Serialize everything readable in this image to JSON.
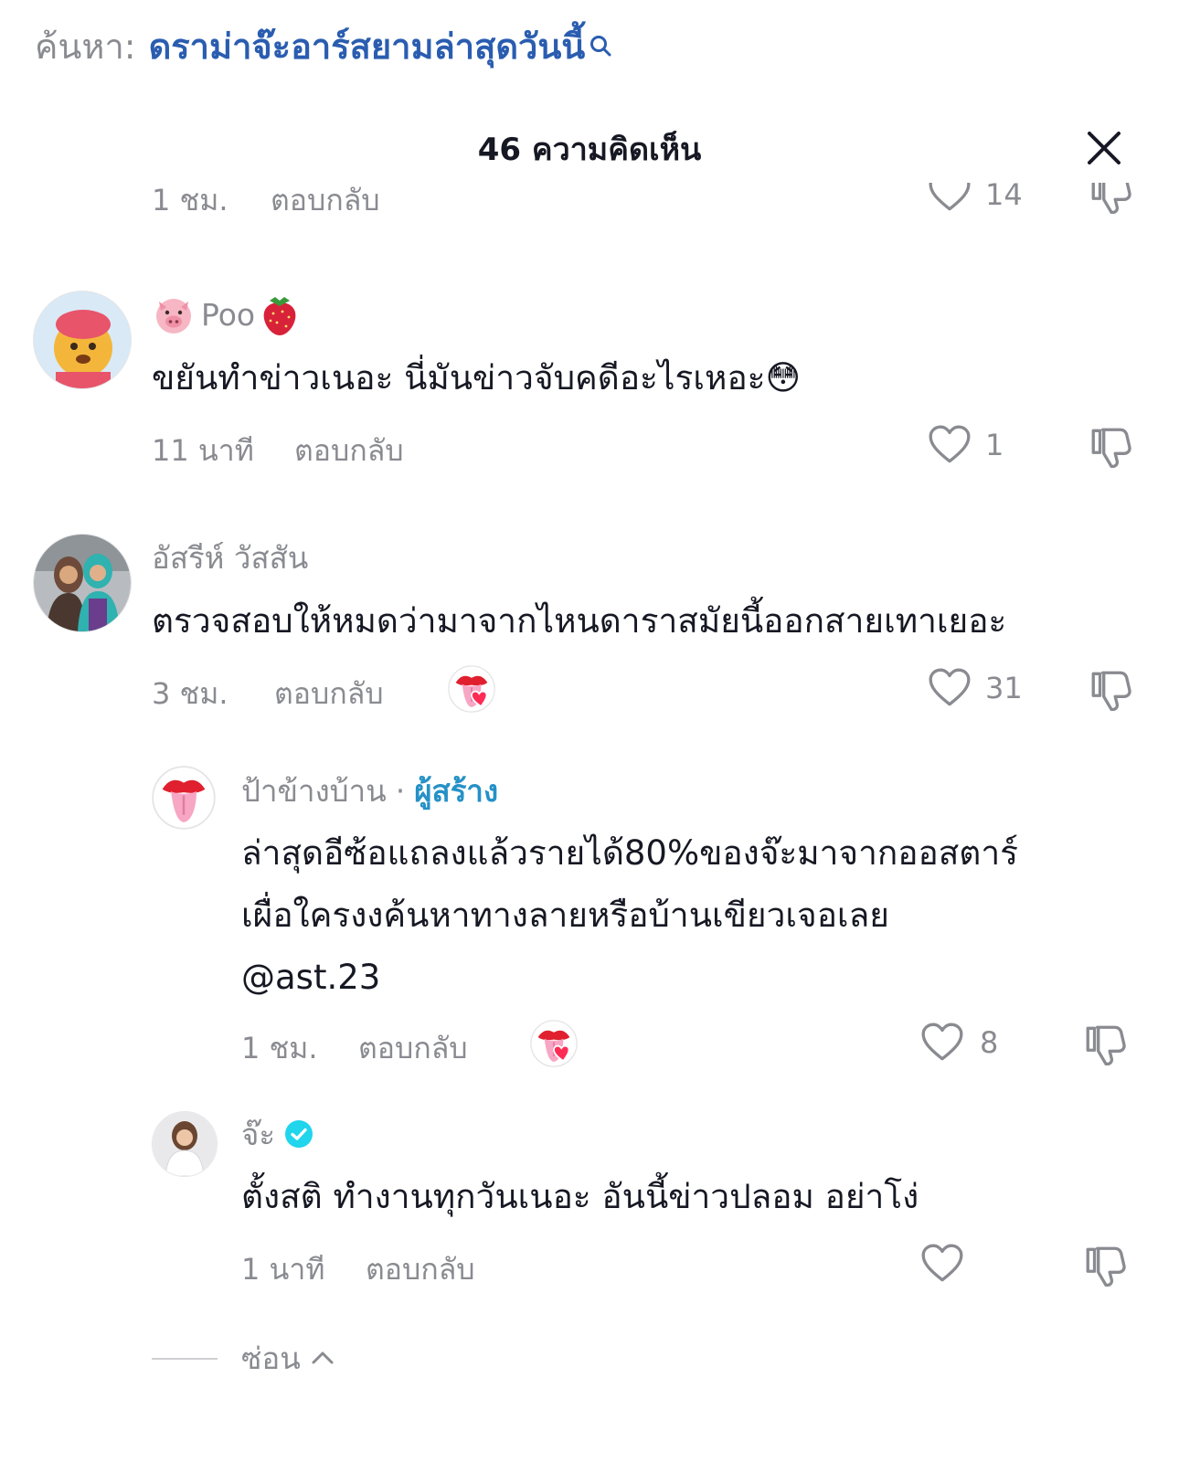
{
  "search": {
    "prefix": "ค้นหา:",
    "query": "ดราม่าจ๊ะอาร์สยามล่าสุดวันนี้"
  },
  "header": {
    "count_title": "46 ความคิดเห็น"
  },
  "partial_comment": {
    "time": "1 ชม.",
    "reply": "ตอบกลับ",
    "likes": "14"
  },
  "comments": [
    {
      "user": "Poo",
      "text": "ขยันทำข่าวเนอะ นี่มันข่าวจับคดีอะไรเหอะ😳",
      "time": "11 นาที",
      "reply": "ตอบกลับ",
      "likes": "1"
    },
    {
      "user": "อัสรีห์ วัสสัน",
      "text": "ตรวจสอบให้หมดว่ามาจากไหนดาราสมัยนี้ออกสายเทาเยอะ",
      "time": "3 ชม.",
      "reply": "ตอบกลับ",
      "likes": "31"
    }
  ],
  "replies": [
    {
      "user": "ป้าข้างบ้าน",
      "separator": "·",
      "badge": "ผู้สร้าง",
      "text_lines": [
        "ล่าสุดอีซ้อแถลงแล้วรายได้80%ของจ๊ะมาจากออสตาร์",
        "เผื่อใครงงค้นหาทางลายหรือบ้านเขียวเจอเลย",
        "@ast.23"
      ],
      "time": "1 ชม.",
      "reply": "ตอบกลับ",
      "likes": "8"
    },
    {
      "user": "จ๊ะ",
      "text": "ตั้งสติ ทำงานทุกวันเนอะ อันนี้ข่าวปลอม อย่าโง่",
      "time": "1 นาที",
      "reply": "ตอบกลับ",
      "likes": ""
    }
  ],
  "footer": {
    "hide_label": "ซ่อน"
  },
  "colors": {
    "query": "#2a5db0",
    "muted": "#8a8b91",
    "creator": "#2591c7",
    "verified": "#20d5ec",
    "heart_red": "#fe2c55"
  },
  "icons": [
    "search-icon",
    "close-icon",
    "heart-icon",
    "dislike-icon",
    "pig-emoji-icon",
    "strawberry-emoji-icon",
    "lips-icon",
    "verified-icon",
    "chevron-up-icon"
  ]
}
